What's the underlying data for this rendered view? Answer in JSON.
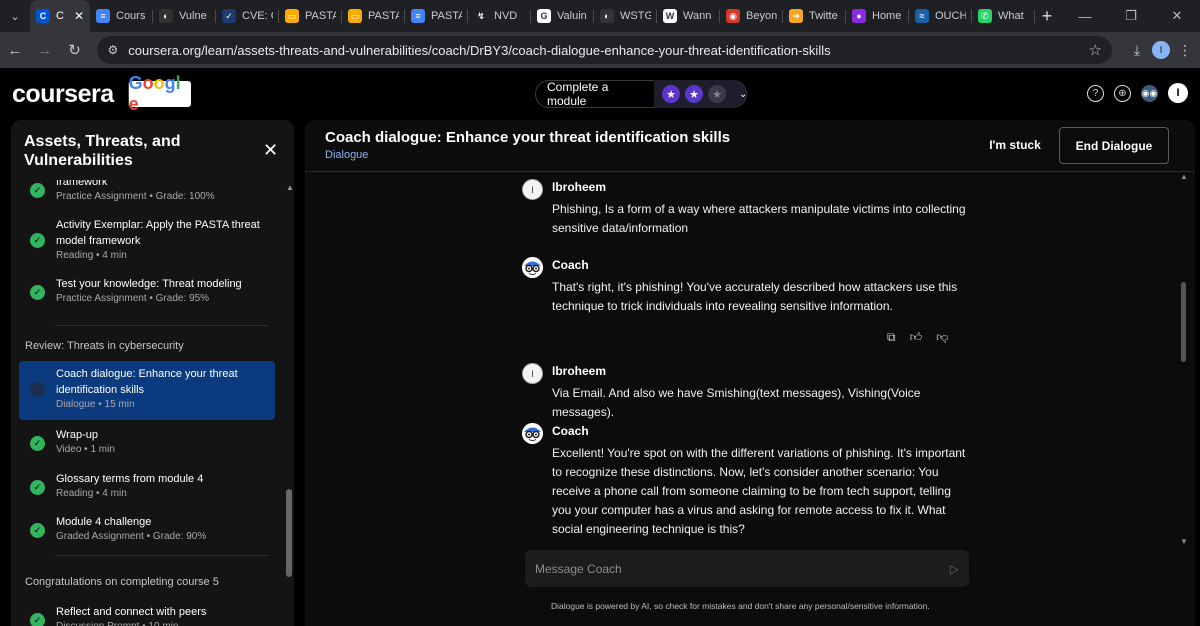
{
  "browser": {
    "tabs": [
      {
        "title": "C",
        "favicon_color": "#0056d2",
        "favicon_glyph": "C",
        "active": true
      },
      {
        "title": "Cours",
        "favicon_color": "#4285f4",
        "favicon_glyph": "≡"
      },
      {
        "title": "Vulne",
        "favicon_color": "#333333",
        "favicon_glyph": "◐"
      },
      {
        "title": "CVE: C",
        "favicon_color": "#1e3a6e",
        "favicon_glyph": "✓"
      },
      {
        "title": "PASTA",
        "favicon_color": "#f9ab00",
        "favicon_glyph": "▭"
      },
      {
        "title": "PASTA",
        "favicon_color": "#f9ab00",
        "favicon_glyph": "▭"
      },
      {
        "title": "PASTA",
        "favicon_color": "#4285f4",
        "favicon_glyph": "≡"
      },
      {
        "title": "NVD",
        "favicon_color": "#222222",
        "favicon_glyph": "↯"
      },
      {
        "title": "Valuin",
        "favicon_color": "#ffffff",
        "favicon_glyph": "G"
      },
      {
        "title": "WSTG",
        "favicon_color": "#333333",
        "favicon_glyph": "◐"
      },
      {
        "title": "Wann",
        "favicon_color": "#ffffff",
        "favicon_glyph": "W"
      },
      {
        "title": "Beyon",
        "favicon_color": "#d33a2c",
        "favicon_glyph": "◉"
      },
      {
        "title": "Twitte",
        "favicon_color": "#f5a623",
        "favicon_glyph": "➜"
      },
      {
        "title": "Home",
        "favicon_color": "#8a2be2",
        "favicon_glyph": "●"
      },
      {
        "title": "OUCH",
        "favicon_color": "#1a5fa8",
        "favicon_glyph": "≈"
      },
      {
        "title": "What",
        "favicon_color": "#25d366",
        "favicon_glyph": "✆"
      }
    ],
    "url": "coursera.org/learn/assets-threats-and-vulnerabilities/coach/DrBY3/coach-dialogue-enhance-your-threat-identification-skills",
    "profile_initial": "I"
  },
  "header": {
    "logo": "coursera",
    "partner": "Google",
    "goal_label": "Complete a module",
    "goal_stars_done": 2,
    "goal_stars_total": 3,
    "avatar_initial": "I"
  },
  "sidebar": {
    "title": "Assets, Threats, and Vulnerabilities",
    "items_top": [
      {
        "title": "framework",
        "meta": "Practice Assignment • Grade: 100%"
      },
      {
        "title": "Activity Exemplar: Apply the PASTA threat model framework",
        "meta": "Reading • 4 min"
      },
      {
        "title": "Test your knowledge: Threat modeling",
        "meta": "Practice Assignment • Grade: 95%"
      }
    ],
    "section_review": "Review: Threats in cybersecurity",
    "items_review": [
      {
        "title": "Coach dialogue: Enhance your threat identification skills",
        "meta": "Dialogue • 15 min",
        "active": true
      },
      {
        "title": "Wrap-up",
        "meta": "Video • 1 min"
      },
      {
        "title": "Glossary terms from module 4",
        "meta": "Reading • 4 min"
      },
      {
        "title": "Module 4 challenge",
        "meta": "Graded Assignment • Grade: 90%"
      }
    ],
    "section_congrats": "Congratulations on completing course 5",
    "items_congrats": [
      {
        "title": "Reflect and connect with peers",
        "meta": "Discussion Prompt • 10 min"
      }
    ]
  },
  "main": {
    "title": "Coach dialogue: Enhance your threat identification skills",
    "subtitle": "Dialogue",
    "stuck_label": "I'm stuck",
    "end_label": "End Dialogue",
    "messages": [
      {
        "sender": "Ibroheem",
        "role": "user",
        "avatar": "I",
        "text": "Phishing, Is a form of a way where attackers manipulate victims into collecting sensitive data/information"
      },
      {
        "sender": "Coach",
        "role": "coach",
        "text": "That's right, it's phishing! You've accurately described how attackers use this technique to trick individuals into revealing sensitive information."
      },
      {
        "sender": "Ibroheem",
        "role": "user",
        "avatar": "I",
        "text": "Via Email. And also we have Smishing(text messages), Vishing(Voice messages)."
      },
      {
        "sender": "Coach",
        "role": "coach",
        "text": "Excellent! You're spot on with the different variations of phishing. It's important to recognize these distinctions. Now, let's consider another scenario: You receive a phone call from someone claiming to be from tech support, telling you your computer has a virus and asking for remote access to fix it. What social engineering technique is this?"
      }
    ],
    "composer_placeholder": "Message Coach",
    "disclaimer": "Dialogue is powered by AI, so check for mistakes and don't share any personal/sensitive information."
  }
}
